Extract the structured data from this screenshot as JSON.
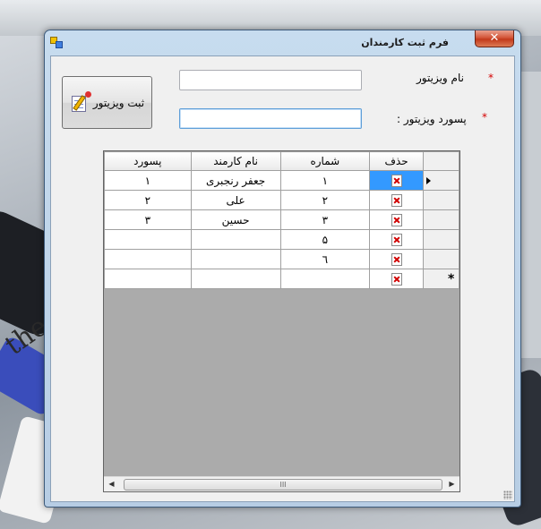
{
  "window": {
    "title": "فرم ثبت کارمندان",
    "close_glyph": "✕"
  },
  "form": {
    "required_star": "*",
    "username_label": "نام ویزیتور",
    "password_label": "پسورد ویزیتور :",
    "username_value": "",
    "password_value": "",
    "submit_label": "ثبت ویزیتور"
  },
  "grid": {
    "columns": {
      "delete": "حذف",
      "number": "شماره",
      "name": "نام کارمند",
      "password": "پسورد"
    },
    "rows": [
      {
        "number": "۱",
        "name": "جعفر رنجبری",
        "password": "۱",
        "current": true
      },
      {
        "number": "۲",
        "name": "علی",
        "password": "۲"
      },
      {
        "number": "۳",
        "name": "حسین",
        "password": "۳"
      },
      {
        "number": "۵",
        "name": "",
        "password": ""
      },
      {
        "number": "٦",
        "name": "",
        "password": ""
      }
    ],
    "new_row_marker": "*",
    "scroll_thumb_glyph": "III"
  },
  "background": {
    "text": "the"
  }
}
